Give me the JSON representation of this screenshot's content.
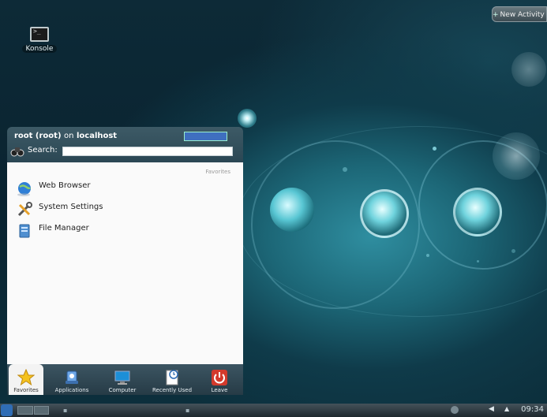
{
  "desktop": {
    "icons": [
      {
        "label": "Konsole",
        "icon": "terminal-icon"
      }
    ],
    "new_activity_label": "New Activity"
  },
  "launcher": {
    "user": "root (root)",
    "on_text": "on",
    "host": "localhost",
    "search_label": "Search:",
    "search_value": "",
    "favorites_heading": "Favorites",
    "favorites": [
      {
        "label": "Web Browser",
        "icon": "web-browser-icon"
      },
      {
        "label": "System Settings",
        "icon": "system-settings-icon"
      },
      {
        "label": "File Manager",
        "icon": "file-manager-icon"
      }
    ],
    "tabs": [
      {
        "label": "Favorites",
        "icon": "star-icon",
        "active": true
      },
      {
        "label": "Applications",
        "icon": "applications-icon",
        "active": false
      },
      {
        "label": "Computer",
        "icon": "computer-icon",
        "active": false
      },
      {
        "label": "Recently Used",
        "icon": "clock-icon",
        "active": false
      },
      {
        "label": "Leave",
        "icon": "power-icon",
        "active": false
      }
    ]
  },
  "taskbar": {
    "clock": "09:34"
  },
  "colors": {
    "accent": "#3b8fb0",
    "leave_red": "#d33a2c"
  }
}
